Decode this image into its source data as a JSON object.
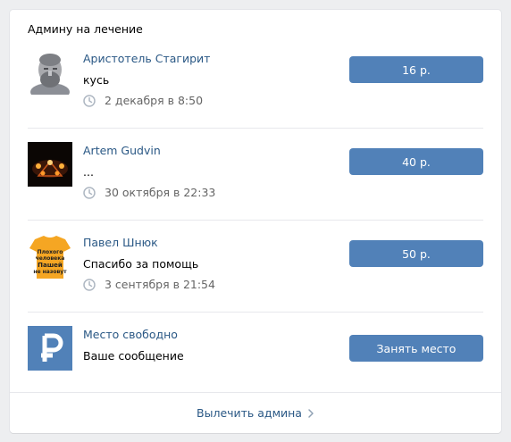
{
  "widget": {
    "title": "Админу на лечение",
    "footer_link": "Вылечить админа",
    "footer_icon": "chevron-right-icon"
  },
  "donors": [
    {
      "name": "Аристотель Стагирит",
      "message": "кусь",
      "time": "2 декабря в 8:50",
      "amount": "16 р.",
      "avatar": "aristotle-bust-photo"
    },
    {
      "name": "Artem Gudvin",
      "message": "...",
      "time": "30 октября в 22:33",
      "amount": "40 р.",
      "avatar": "candles-dark-photo"
    },
    {
      "name": "Павел Шнюк",
      "message": "Спасибо за помощь",
      "time": "3 сентября в 21:54",
      "amount": "50 р.",
      "avatar": "orange-tshirt-photo"
    }
  ],
  "free_slot": {
    "name": "Место свободно",
    "message": "Ваше сообщение",
    "button": "Занять место",
    "avatar_symbol": "₽",
    "avatar_icon": "ruble-icon"
  },
  "tshirt_text": "Плохого человека Пашей не назовут",
  "colors": {
    "link": "#2a5885",
    "button": "#5181b8",
    "background": "#edeef0",
    "separator": "#e7e8ec",
    "ruble_tile": "#5181b8",
    "tshirt": "#f5a623"
  }
}
